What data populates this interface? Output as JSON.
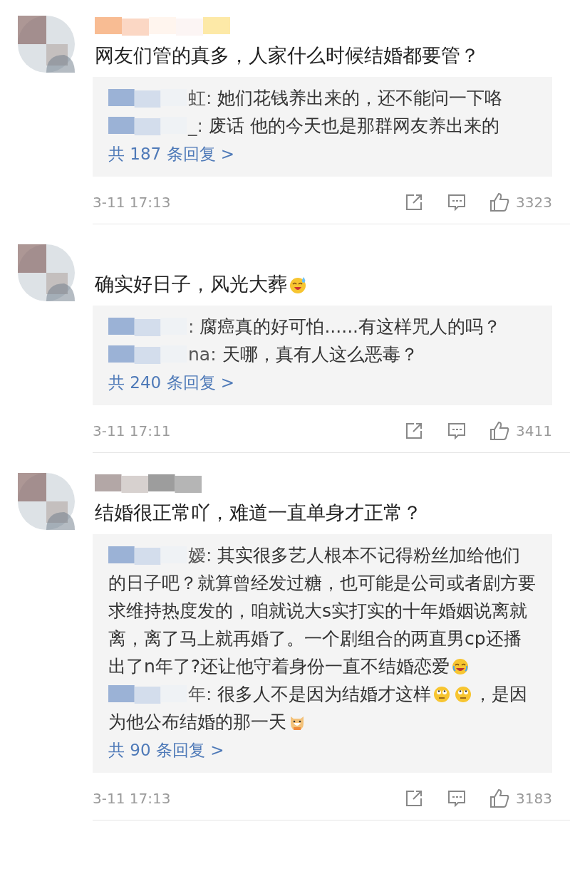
{
  "comments": [
    {
      "name_hidden": true,
      "parts": [
        {
          "kind": "text",
          "text": "网友们管的真多，人家什么时候结婚都要管？"
        }
      ],
      "replies": [
        {
          "name_hidden": true,
          "author": "虹:",
          "parts": [
            {
              "kind": "text",
              "text": "她们花钱养出来的，还不能问一下咯"
            }
          ]
        },
        {
          "name_hidden": true,
          "author": "_:",
          "parts": [
            {
              "kind": "text",
              "text": "废话 他的今天也是那群网友养出来的"
            }
          ]
        }
      ],
      "more": "共 187 条回复 >",
      "time": "3-11 17:13",
      "likes": "3323"
    },
    {
      "name_hidden": false,
      "parts": [
        {
          "kind": "text",
          "text": "确实好日子，风光大葬"
        },
        {
          "kind": "sweat"
        }
      ],
      "replies": [
        {
          "name_hidden": true,
          "author": ":",
          "parts": [
            {
              "kind": "text",
              "text": "腐癌真的好可怕......有这样咒人的吗？"
            }
          ]
        },
        {
          "name_hidden": true,
          "author": "na:",
          "parts": [
            {
              "kind": "text",
              "text": "天哪，真有人这么恶毒？"
            }
          ]
        }
      ],
      "more": "共 240 条回复 >",
      "time": "3-11 17:11",
      "likes": "3411"
    },
    {
      "name_hidden": true,
      "parts": [
        {
          "kind": "text",
          "text": "结婚很正常吖，难道一直单身才正常？"
        }
      ],
      "replies": [
        {
          "name_hidden": true,
          "author": "嫒:",
          "parts": [
            {
              "kind": "text",
              "text": "其实很多艺人根本不记得粉丝加给他们的日子吧？就算曾经发过糖，也可能是公司或者剧方要求维持热度发的，咱就说大s实打实的十年婚姻说离就离，离了马上就再婚了。一个剧组合的两直男cp还播出了n年了?还让他守着身份一直不结婚恋爱"
            },
            {
              "kind": "laugh"
            }
          ]
        },
        {
          "name_hidden": true,
          "author": "年:",
          "parts": [
            {
              "kind": "text",
              "text": "很多人不是因为结婚才这样"
            },
            {
              "kind": "eyeroll"
            },
            {
              "kind": "eyeroll"
            },
            {
              "kind": "text",
              "text": "，是因为他公布结婚的那一天"
            },
            {
              "kind": "dog"
            }
          ]
        }
      ],
      "more": "共 90 条回复 >",
      "time": "3-11 17:13",
      "likes": "3183"
    }
  ]
}
